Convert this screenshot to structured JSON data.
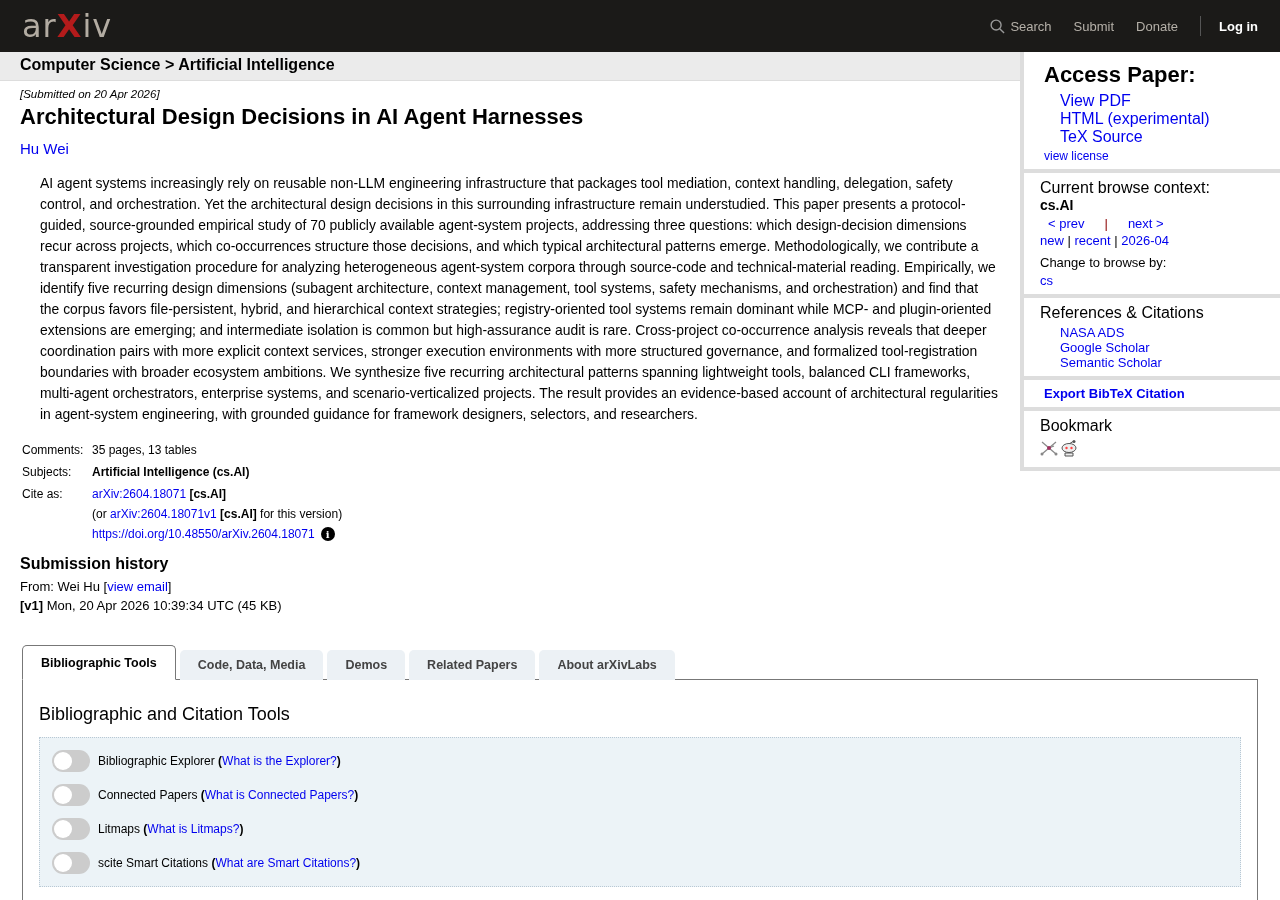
{
  "header": {
    "logo": "arXiv",
    "nav": [
      {
        "label": "Search",
        "kind": "search"
      },
      {
        "label": "Submit",
        "kind": "link"
      },
      {
        "label": "Donate",
        "kind": "link"
      },
      {
        "label": "Log in",
        "kind": "login"
      }
    ]
  },
  "breadcrumb": "Computer Science > Artificial Intelligence",
  "paper": {
    "submitted": "[Submitted on 20 Apr 2026]",
    "title": "Architectural Design Decisions in AI Agent Harnesses",
    "author": "Hu Wei",
    "abstract": "AI agent systems increasingly rely on reusable non-LLM engineering infrastructure that packages tool mediation, context handling, delegation, safety control, and orchestration. Yet the architectural design decisions in this surrounding infrastructure remain understudied. This paper presents a protocol-guided, source-grounded empirical study of 70 publicly available agent-system projects, addressing three questions: which design-decision dimensions recur across projects, which co-occurrences structure those decisions, and which typical architectural patterns emerge. Methodologically, we contribute a transparent investigation procedure for analyzing heterogeneous agent-system corpora through source-code and technical-material reading. Empirically, we identify five recurring design dimensions (subagent architecture, context management, tool systems, safety mechanisms, and orchestration) and find that the corpus favors file-persistent, hybrid, and hierarchical context strategies; registry-oriented tool systems remain dominant while MCP- and plugin-oriented extensions are emerging; and intermediate isolation is common but high-assurance audit is rare. Cross-project co-occurrence analysis reveals that deeper coordination pairs with more explicit context services, stronger execution environments with more structured governance, and formalized tool-registration boundaries with broader ecosystem ambitions. We synthesize five recurring architectural patterns spanning lightweight tools, balanced CLI frameworks, multi-agent orchestrators, enterprise systems, and scenario-verticalized projects. The result provides an evidence-based account of architectural regularities in agent-system engineering, with grounded guidance for framework designers, selectors, and researchers."
  },
  "metadata": [
    {
      "label": "Comments:",
      "lines": [
        [
          {
            "kind": "plain",
            "text": "35 pages, 13 tables"
          }
        ]
      ]
    },
    {
      "label": "Subjects:",
      "lines": [
        [
          {
            "kind": "bold",
            "text": "Artificial Intelligence (cs.AI)"
          }
        ]
      ]
    },
    {
      "label": "Cite as:",
      "lines": [
        [
          {
            "kind": "link",
            "text": "arXiv:2604.18071"
          },
          {
            "kind": "bold",
            "text": " [cs.AI]"
          }
        ],
        [
          {
            "kind": "plain",
            "text": "(or "
          },
          {
            "kind": "link",
            "text": "arXiv:2604.18071v1"
          },
          {
            "kind": "bold",
            "text": " [cs.AI]"
          },
          {
            "kind": "plain",
            "text": " for this version)"
          }
        ],
        [
          {
            "kind": "link",
            "text": "https://doi.org/10.48550/arXiv.2604.18071"
          },
          {
            "kind": "info",
            "text": "i"
          }
        ]
      ]
    }
  ],
  "history": {
    "heading": "Submission history",
    "from": [
      {
        "kind": "plain",
        "text": "From: Wei Hu ["
      },
      {
        "kind": "link",
        "text": "view email"
      },
      {
        "kind": "plain",
        "text": "]"
      }
    ],
    "version": "**[v1]** Mon, 20 Apr 2026 10:39:34 UTC (45 KB)"
  },
  "sidebar": {
    "access": {
      "heading": "Access Paper:",
      "links": [
        "View PDF",
        "HTML (experimental)",
        "TeX Source"
      ],
      "license": "view license"
    },
    "browse": {
      "heading": "Current browse context:",
      "context": "cs.AI",
      "nav": [
        {
          "kind": "link",
          "text": "< prev"
        },
        {
          "kind": "sep",
          "text": "|"
        },
        {
          "kind": "link",
          "text": "next >"
        }
      ],
      "lists": [
        {
          "kind": "link",
          "text": "new"
        },
        {
          "kind": "plain",
          "text": " | "
        },
        {
          "kind": "link",
          "text": "recent"
        },
        {
          "kind": "plain",
          "text": " | "
        },
        {
          "kind": "link",
          "text": "2026-04"
        }
      ],
      "change": "Change to browse by:",
      "change_links": [
        "cs"
      ]
    },
    "references": {
      "heading": "References & Citations",
      "links": [
        "NASA ADS",
        "Google Scholar",
        "Semantic Scholar"
      ]
    },
    "export": "Export BibTeX Citation",
    "bookmark": {
      "heading": "Bookmark",
      "icons": [
        {
          "kind": "network"
        },
        {
          "kind": "robot"
        }
      ]
    }
  },
  "tabs": [
    {
      "label": "Bibliographic Tools",
      "selected": true
    },
    {
      "label": "Code, Data, Media",
      "selected": false
    },
    {
      "label": "Demos",
      "selected": false
    },
    {
      "label": "Related Papers",
      "selected": false
    },
    {
      "label": "About arXivLabs",
      "selected": false
    }
  ],
  "tools": {
    "heading": "Bibliographic and Citation Tools",
    "toggles": [
      {
        "on": false,
        "parts": [
          {
            "kind": "plain",
            "text": "Bibliographic Explorer "
          },
          {
            "kind": "bold",
            "text": "("
          },
          {
            "kind": "link",
            "text": "What is the Explorer?"
          },
          {
            "kind": "bold",
            "text": ")"
          }
        ]
      },
      {
        "on": false,
        "parts": [
          {
            "kind": "plain",
            "text": "Connected Papers "
          },
          {
            "kind": "bold",
            "text": "("
          },
          {
            "kind": "link",
            "text": "What is Connected Papers?"
          },
          {
            "kind": "bold",
            "text": ")"
          }
        ]
      },
      {
        "on": false,
        "parts": [
          {
            "kind": "plain",
            "text": "Litmaps "
          },
          {
            "kind": "bold",
            "text": "("
          },
          {
            "kind": "link",
            "text": "What is Litmaps?"
          },
          {
            "kind": "bold",
            "text": ")"
          }
        ]
      },
      {
        "on": false,
        "parts": [
          {
            "kind": "plain",
            "text": "scite Smart Citations "
          },
          {
            "kind": "bold",
            "text": "("
          },
          {
            "kind": "link",
            "text": "What are Smart Citations?"
          },
          {
            "kind": "bold",
            "text": ")"
          }
        ]
      }
    ]
  }
}
